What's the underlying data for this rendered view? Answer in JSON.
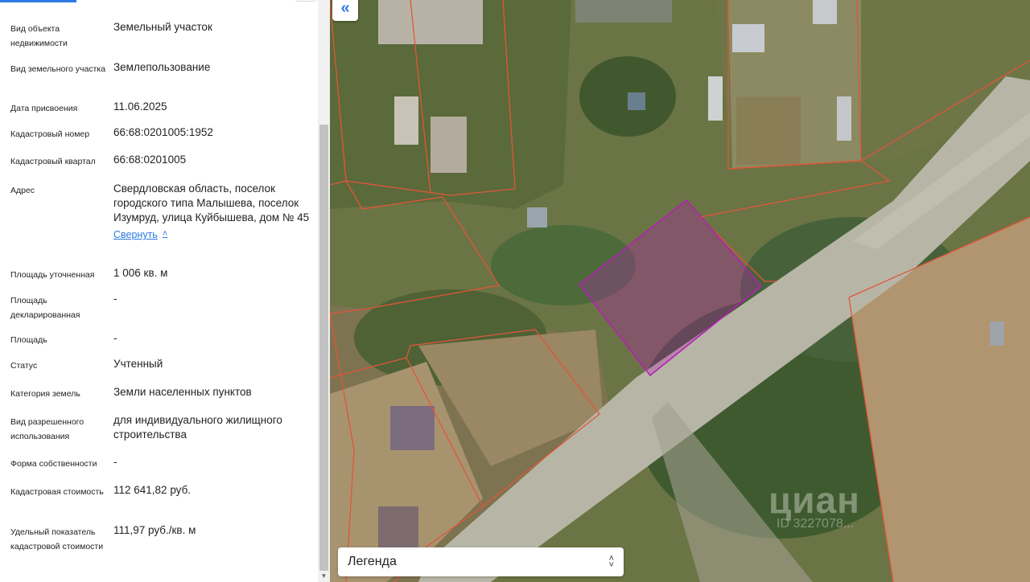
{
  "fields": [
    {
      "label": "Вид объекта недвижимости",
      "value": "Земельный участок"
    },
    {
      "label": "Вид земельного участка",
      "value": "Землепользование"
    },
    {
      "label": "Дата присвоения",
      "value": "11.06.2025"
    },
    {
      "label": "Кадастровый номер",
      "value": "66:68:0201005:1952"
    },
    {
      "label": "Кадастровый квартал",
      "value": "66:68:0201005"
    },
    {
      "label": "Адрес",
      "value": "Свердловская область, поселок городского типа Малышева, поселок Изумруд, улица Куйбышева, дом № 45"
    },
    {
      "label": "Площадь уточненная",
      "value": "1 006 кв. м"
    },
    {
      "label": "Площадь декларированная",
      "value": "-"
    },
    {
      "label": "Площадь",
      "value": "-"
    },
    {
      "label": "Статус",
      "value": "Учтенный"
    },
    {
      "label": "Категория земель",
      "value": "Земли населенных пунктов"
    },
    {
      "label": "Вид разрешенного использования",
      "value": "для индивидуального жилищного строительства"
    },
    {
      "label": "Форма собственности",
      "value": "-"
    },
    {
      "label": "Кадастровая стоимость",
      "value": "112 641,82 руб."
    },
    {
      "label": "Удельный показатель кадастровой стоимости",
      "value": "111,97 руб./кв. м"
    }
  ],
  "address_collapse_link": "Свернуть",
  "map": {
    "collapse_icon": "double-chevron-left-icon",
    "legend_label": "Легенда",
    "legend_icon": "up-down-chevron-icon",
    "watermark_brand": "циан",
    "watermark_id": "ID 3227078..."
  },
  "colors": {
    "accent": "#2d7ae3",
    "parcel_boundary": "#e2553a",
    "selected_parcel": "#b51fb5"
  }
}
